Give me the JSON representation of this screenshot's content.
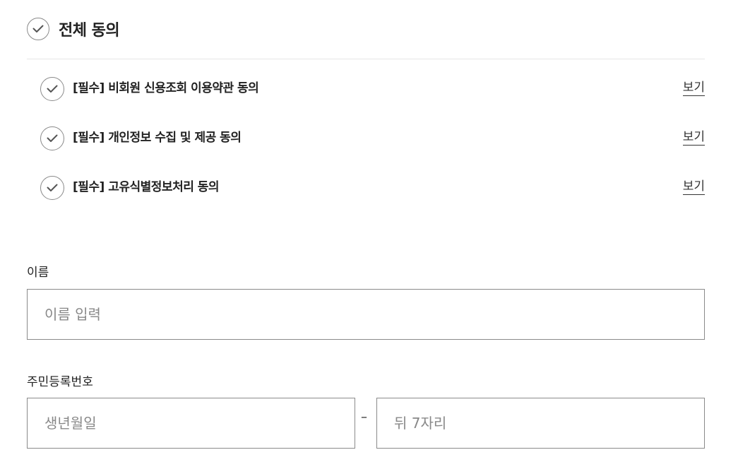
{
  "agreement": {
    "all_label": "전체 동의",
    "terms": [
      {
        "label": "[필수] 비회원 신용조회 이용약관 동의",
        "link": "보기"
      },
      {
        "label": "[필수] 개인정보 수집 및 제공 동의",
        "link": "보기"
      },
      {
        "label": "[필수] 고유식별정보처리 동의",
        "link": "보기"
      }
    ]
  },
  "form": {
    "name": {
      "label": "이름",
      "placeholder": "이름 입력",
      "value": ""
    },
    "resident_number": {
      "label": "주민등록번호",
      "front_placeholder": "생년월일",
      "separator": "–",
      "back_placeholder": "뒤 7자리"
    }
  },
  "colors": {
    "text": "#222222",
    "border": "#8a8a8a",
    "divider": "#e6e6e6",
    "placeholder": "#888888"
  },
  "icons": {
    "check": "check-circle-icon"
  }
}
